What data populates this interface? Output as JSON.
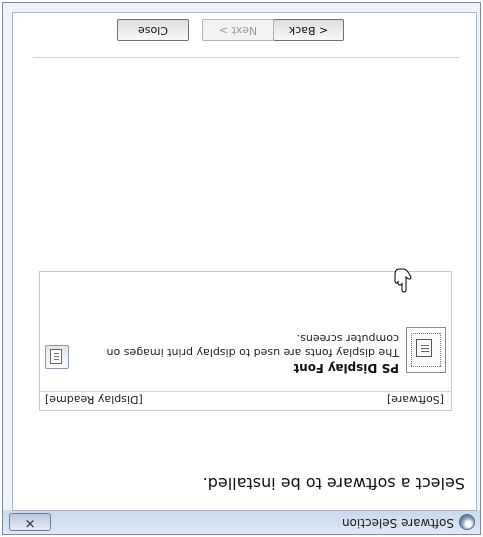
{
  "window": {
    "title": "Software Selection",
    "close_label": "✕"
  },
  "main": {
    "heading": "Select a software to be installed.",
    "columns": {
      "software": "[Software]",
      "readme": "[Display Readme]"
    },
    "items": [
      {
        "name": "PS Display Font",
        "description": "The display fonts are used to display print images on computer screens."
      }
    ]
  },
  "footer": {
    "back_label": "< Back",
    "next_label": "Next >",
    "close_label": "Close"
  },
  "icons": [
    "app-icon",
    "document-icon",
    "readme-icon",
    "hand-cursor-icon"
  ]
}
